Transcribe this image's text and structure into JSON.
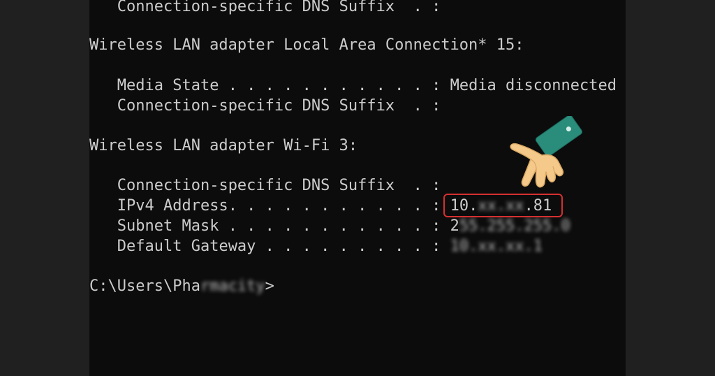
{
  "console": {
    "lines": [
      {
        "indent": "   ",
        "label": "Connection-specific DNS Suffix  . :",
        "value": ""
      },
      {
        "indent": "",
        "label": "Wireless LAN adapter Local Area Connection* 15:",
        "value": ""
      },
      {
        "indent": "   ",
        "label": "Media State . . . . . . . . . . . : ",
        "value": "Media disconnected"
      },
      {
        "indent": "   ",
        "label": "Connection-specific DNS Suffix  . :",
        "value": ""
      },
      {
        "indent": "",
        "label": "Wireless LAN adapter Wi-Fi 3:",
        "value": ""
      },
      {
        "indent": "   ",
        "label": "Connection-specific DNS Suffix  . :",
        "value": ""
      },
      {
        "indent": "   ",
        "label": "IPv4 Address. . . . . . . . . . . : ",
        "value": "10.",
        "blurred": "xx.xx",
        "value_end": ".81"
      },
      {
        "indent": "   ",
        "label": "Subnet Mask . . . . . . . . . . . : ",
        "value": "2",
        "blurred": "55.255.255.0"
      },
      {
        "indent": "   ",
        "label": "Default Gateway . . . . . . . . . : ",
        "value": "",
        "blurred": "10.xx.xx.1"
      },
      {
        "indent": "",
        "label": "C:\\Users\\Pha",
        "blurred": "rmacity",
        "value_end": ">"
      }
    ]
  },
  "colors": {
    "text": "#cccccc",
    "console_bg": "#0c0c0c",
    "highlight": "#d62f2f",
    "cuff": "#2a8c7a",
    "skin": "#f5c98a"
  },
  "icons": {
    "pointer": "pointing-hand-icon"
  }
}
